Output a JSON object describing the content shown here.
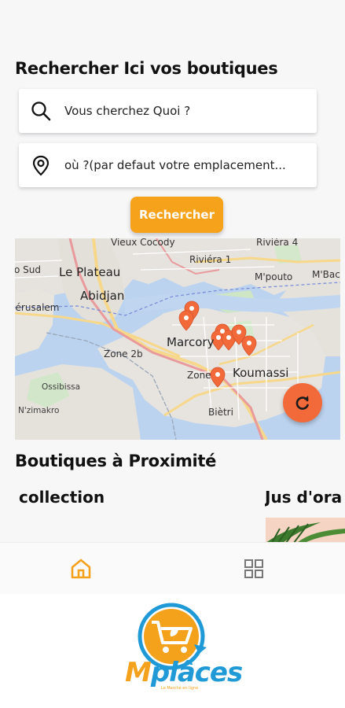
{
  "search": {
    "title": "Rechercher Ici vos boutiques",
    "what_placeholder": "Vous cherchez Quoi ?",
    "where_placeholder": "où ?(par defaut votre emplacement...",
    "button_label": "Rechercher"
  },
  "map": {
    "labels": {
      "vieux_cocody": "Vieux Cocody",
      "riviera4": "Riviéra 4",
      "sud": "o Sud",
      "le_plateau": "Le Plateau",
      "riviera1": "Riviéra 1",
      "mpouto": "M'pouto",
      "mbac": "M'Bac",
      "abidjan": "Abidjan",
      "jerusalem": "Jérusalem",
      "marcory": "Marcory",
      "zone2b": "Zone 2b",
      "koumassi": "Koumassi",
      "zone_e": "Zone",
      "ossibissa": "Ossibissa",
      "nzimakro": "N'zimakro",
      "bietri": "Biètri"
    },
    "refresh_icon": "refresh-icon",
    "pin_color": "#f26a3a"
  },
  "nearby": {
    "title": "Boutiques à Proximité",
    "cards": [
      {
        "title": "collection"
      },
      {
        "title": "Jus d'ora"
      }
    ]
  },
  "nav": {
    "home_icon": "home-icon",
    "grid_icon": "grid-icon",
    "active_color": "#f4a11b"
  },
  "brand": {
    "logo_m": "M",
    "logo_rest": "plâces",
    "tagline": "Le Marché en ligne"
  }
}
